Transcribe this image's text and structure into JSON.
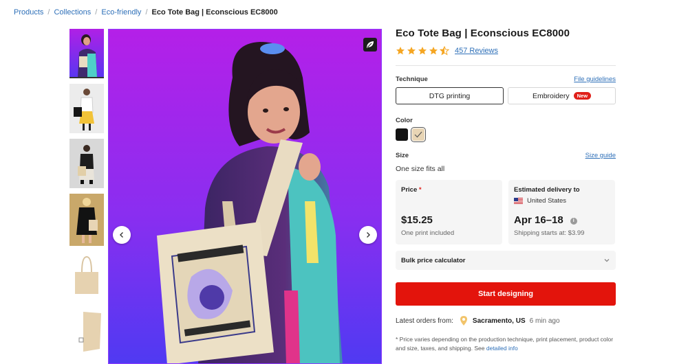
{
  "breadcrumb": {
    "items": [
      "Products",
      "Collections",
      "Eco-friendly"
    ],
    "current": "Eco Tote Bag | Econscious EC8000",
    "separator": "/"
  },
  "gallery": {
    "thumbnail_count": 6,
    "active_thumbnail": 1
  },
  "product": {
    "title": "Eco Tote Bag | Econscious EC8000",
    "rating": 4.5,
    "reviews_label": "457 Reviews"
  },
  "technique": {
    "label": "Technique",
    "guidelines_link": "File guidelines",
    "options": [
      "DTG printing",
      "Embroidery"
    ],
    "selected": "DTG printing",
    "new_badge": "New"
  },
  "color": {
    "label": "Color",
    "options": [
      {
        "name": "black",
        "hex": "#121212"
      },
      {
        "name": "natural",
        "hex": "#e8d5b5"
      }
    ],
    "selected": "natural"
  },
  "size": {
    "label": "Size",
    "guide_link": "Size guide",
    "value": "One size fits all"
  },
  "price": {
    "label": "Price",
    "required_mark": "*",
    "amount": "$15.25",
    "note": "One print included"
  },
  "delivery": {
    "label": "Estimated delivery to",
    "country": "United States",
    "dates": "Apr 16–18",
    "shipping": "Shipping starts at: $3.99"
  },
  "bulk": {
    "label": "Bulk price calculator"
  },
  "cta": {
    "label": "Start designing"
  },
  "orders": {
    "label": "Latest orders from:",
    "city": "Sacramento, US",
    "ago": "6 min ago"
  },
  "footnote": {
    "text": "* Price varies depending on the production technique, print placement, product color and size, taxes, and shipping. See",
    "link": "detailed info"
  },
  "colors": {
    "link": "#2d6fb8",
    "cta": "#e3140c",
    "star": "#f5a623",
    "hero_bg_top": "#b120e6",
    "hero_bg_bottom": "#5b34f0"
  },
  "icons": [
    "chevron-left-icon",
    "chevron-right-icon",
    "eco-leaf-icon",
    "star-icon",
    "info-icon",
    "chevron-down-icon",
    "location-pin-icon",
    "us-flag-icon"
  ]
}
